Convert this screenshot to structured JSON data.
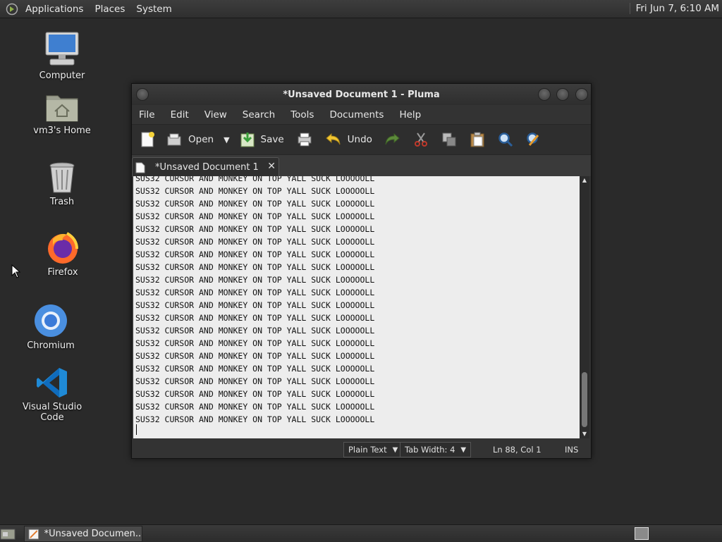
{
  "top_panel": {
    "menus": [
      "Applications",
      "Places",
      "System"
    ],
    "clock": "Fri Jun  7,  6:10 AM"
  },
  "desktop_icons": [
    {
      "label": "Computer",
      "icon": "computer-icon"
    },
    {
      "label": "vm3's Home",
      "icon": "home-folder-icon"
    },
    {
      "label": "Trash",
      "icon": "trash-icon"
    },
    {
      "label": "Firefox",
      "icon": "firefox-icon"
    },
    {
      "label": "Chromium",
      "icon": "chromium-icon"
    },
    {
      "label": "Visual Studio Code",
      "icon": "vscode-icon"
    }
  ],
  "window": {
    "title": "*Unsaved Document 1 - Pluma",
    "menu": [
      "File",
      "Edit",
      "View",
      "Search",
      "Tools",
      "Documents",
      "Help"
    ],
    "toolbar": {
      "open_label": "Open",
      "save_label": "Save",
      "undo_label": "Undo"
    },
    "tab": {
      "label": "*Unsaved Document 1",
      "close": "✕"
    },
    "editor_lines": [
      "SUS32 CURSOR AND MONKEY ON TOP YALL SUCK LOOOOOLL",
      "SUS32 CURSOR AND MONKEY ON TOP YALL SUCK LOOOOOLL",
      "SUS32 CURSOR AND MONKEY ON TOP YALL SUCK LOOOOOLL",
      "SUS32 CURSOR AND MONKEY ON TOP YALL SUCK LOOOOOLL",
      "SUS32 CURSOR AND MONKEY ON TOP YALL SUCK LOOOOOLL",
      "SUS32 CURSOR AND MONKEY ON TOP YALL SUCK LOOOOOLL",
      "SUS32 CURSOR AND MONKEY ON TOP YALL SUCK LOOOOOLL",
      "SUS32 CURSOR AND MONKEY ON TOP YALL SUCK LOOOOOLL",
      "SUS32 CURSOR AND MONKEY ON TOP YALL SUCK LOOOOOLL",
      "SUS32 CURSOR AND MONKEY ON TOP YALL SUCK LOOOOOLL",
      "SUS32 CURSOR AND MONKEY ON TOP YALL SUCK LOOOOOLL",
      "SUS32 CURSOR AND MONKEY ON TOP YALL SUCK LOOOOOLL",
      "SUS32 CURSOR AND MONKEY ON TOP YALL SUCK LOOOOOLL",
      "SUS32 CURSOR AND MONKEY ON TOP YALL SUCK LOOOOOLL",
      "SUS32 CURSOR AND MONKEY ON TOP YALL SUCK LOOOOOLL",
      "SUS32 CURSOR AND MONKEY ON TOP YALL SUCK LOOOOOLL",
      "SUS32 CURSOR AND MONKEY ON TOP YALL SUCK LOOOOOLL",
      "SUS32 CURSOR AND MONKEY ON TOP YALL SUCK LOOOOOLL",
      "SUS32 CURSOR AND MONKEY ON TOP YALL SUCK LOOOOOLL",
      "SUS32 CURSOR AND MONKEY ON TOP YALL SUCK LOOOOOLL"
    ],
    "status": {
      "language": "Plain Text",
      "tab_width": "Tab Width:  4",
      "position": "Ln 88, Col 1",
      "mode": "INS"
    }
  },
  "bottom_panel": {
    "task_label": "*Unsaved Documen..."
  }
}
